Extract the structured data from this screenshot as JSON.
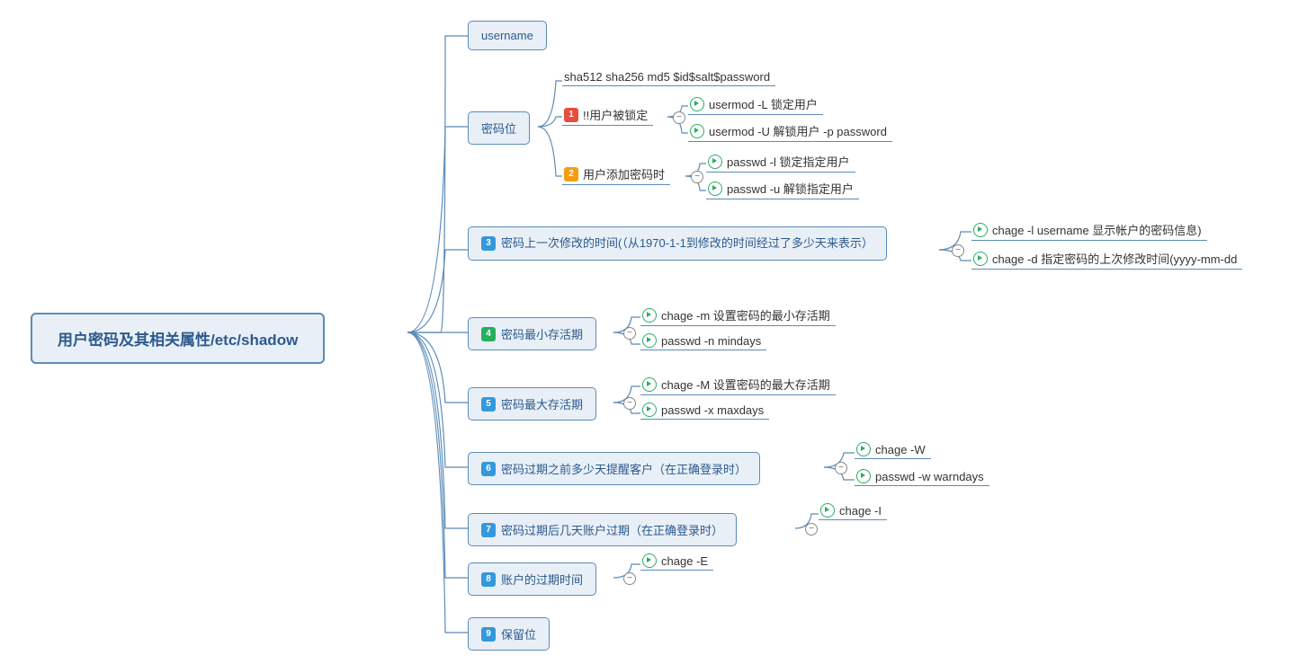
{
  "root": "用户密码及其相关属性/etc/shadow",
  "n1": "username",
  "n2": "密码位",
  "n2a": "sha512 sha256 md5  $id$salt$password",
  "n2b": "!!用户被锁定",
  "n2b1": "usermod -L 锁定用户",
  "n2b2": "usermod -U 解锁用户 -p password",
  "n2c": "用户添加密码时",
  "n2c1": "passwd  -l  锁定指定用户",
  "n2c2": "passwd -u  解锁指定用户",
  "n3": "密码上一次修改的时间(（从1970-1-1到修改的时间经过了多少天来表示）",
  "n3a": "chage -l username 显示帐户的密码信息)",
  "n3b": "chage       -d 指定密码的上次修改时间(yyyy-mm-dd",
  "n4": "密码最小存活期",
  "n4a": "chage   -m 设置密码的最小存活期",
  "n4b": "passwd  -n  mindays",
  "n5": "密码最大存活期",
  "n5a": "chage   -M 设置密码的最大存活期",
  "n5b": "passwd  -x  maxdays",
  "n6": "密码过期之前多少天提醒客户（在正确登录时）",
  "n6a": "chage   -W",
  "n6b": "passwd  -w   warndays",
  "n7": "密码过期后几天账户过期（在正确登录时）",
  "n7a": "chage   -I",
  "n8": "账户的过期时间",
  "n8a": "chage  -E",
  "n9": "保留位"
}
